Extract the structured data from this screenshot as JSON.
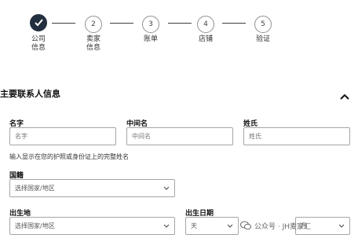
{
  "stepper": {
    "steps": [
      {
        "number": "",
        "label": "公司\n信息",
        "state": "done"
      },
      {
        "number": "2",
        "label": "卖家\n信息",
        "state": "pending"
      },
      {
        "number": "3",
        "label": "账单",
        "state": "pending"
      },
      {
        "number": "4",
        "label": "店铺",
        "state": "pending"
      },
      {
        "number": "5",
        "label": "验证",
        "state": "pending"
      }
    ]
  },
  "section": {
    "title": "主要联系人信息",
    "collapse_icon": "chevron-up-icon"
  },
  "form": {
    "first_name": {
      "label": "名字",
      "placeholder": "名字"
    },
    "middle_name": {
      "label": "中间名",
      "placeholder": "中间名"
    },
    "last_name": {
      "label": "姓氏",
      "placeholder": "姓氏"
    },
    "helper_text": "输入显示在您的护照或身份证上的完整姓名",
    "nationality": {
      "label": "国籍",
      "value": "选择国家/地区"
    },
    "birthplace": {
      "label": "出生地",
      "value": "选择国家/地区"
    },
    "birthdate": {
      "label": "出生日期",
      "day_value": "天",
      "month_value": "月"
    }
  },
  "watermark": {
    "text": "公众号 · JH麦家汇"
  },
  "colors": {
    "done_step": "#232f3e",
    "border": "#a6a6a6"
  }
}
